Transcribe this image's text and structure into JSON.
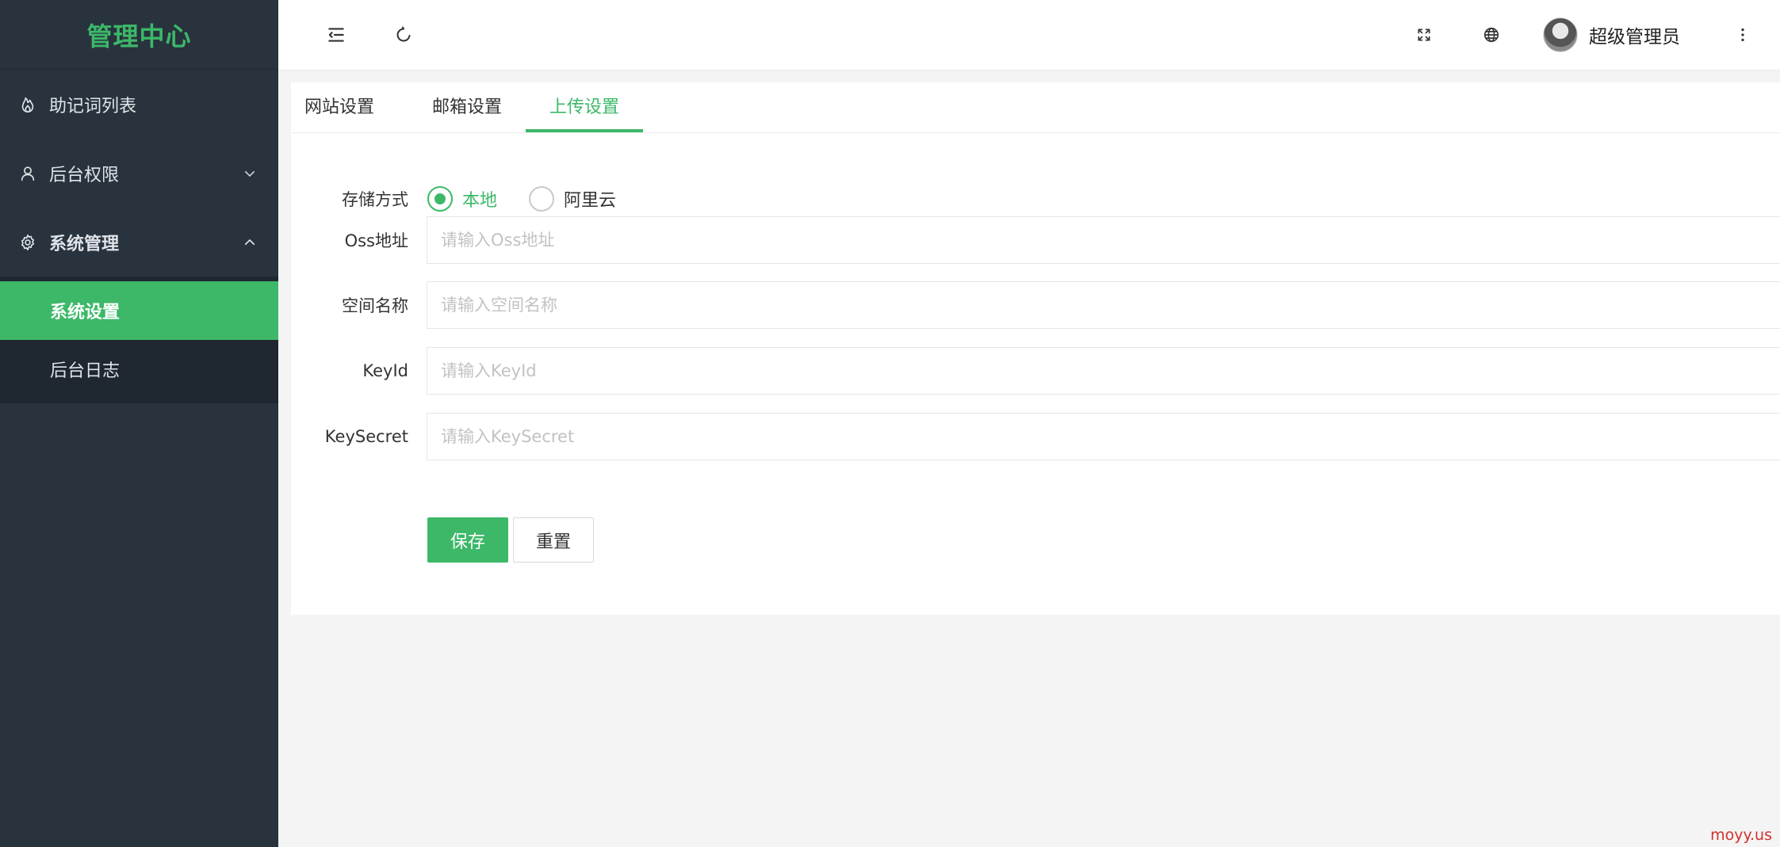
{
  "app": {
    "logo": "管理中心",
    "colors": {
      "accent": "#3cb868",
      "sidebar_bg": "#28333e",
      "submenu_bg": "#1f2730"
    }
  },
  "sidebar": {
    "items": [
      {
        "label": "助记词列表",
        "icon": "fire-icon"
      },
      {
        "label": "后台权限",
        "icon": "user-icon",
        "chevron": "down"
      },
      {
        "label": "系统管理",
        "icon": "gear-icon",
        "chevron": "up",
        "expanded": true,
        "children": [
          {
            "label": "系统设置",
            "active": true
          },
          {
            "label": "后台日志"
          }
        ]
      }
    ]
  },
  "header": {
    "icons": [
      "menu-fold-icon",
      "refresh-icon",
      "fullscreen-icon",
      "globe-icon",
      "more-vertical-icon"
    ],
    "user_name": "超级管理员"
  },
  "tabs": [
    {
      "label": "网站设置"
    },
    {
      "label": "邮箱设置"
    },
    {
      "label": "上传设置",
      "active": true
    }
  ],
  "form": {
    "storage": {
      "label": "存储方式",
      "options": [
        {
          "label": "本地",
          "checked": true
        },
        {
          "label": "阿里云",
          "checked": false
        }
      ]
    },
    "oss": {
      "label": "Oss地址",
      "placeholder": "请输入Oss地址",
      "value": ""
    },
    "bucket": {
      "label": "空间名称",
      "placeholder": "请输入空间名称",
      "value": ""
    },
    "keyid": {
      "label": "KeyId",
      "placeholder": "请输入KeyId",
      "value": ""
    },
    "keysecret": {
      "label": "KeySecret",
      "placeholder": "请输入KeySecret",
      "value": ""
    },
    "save_label": "保存",
    "reset_label": "重置"
  },
  "watermark": "moyy.us"
}
